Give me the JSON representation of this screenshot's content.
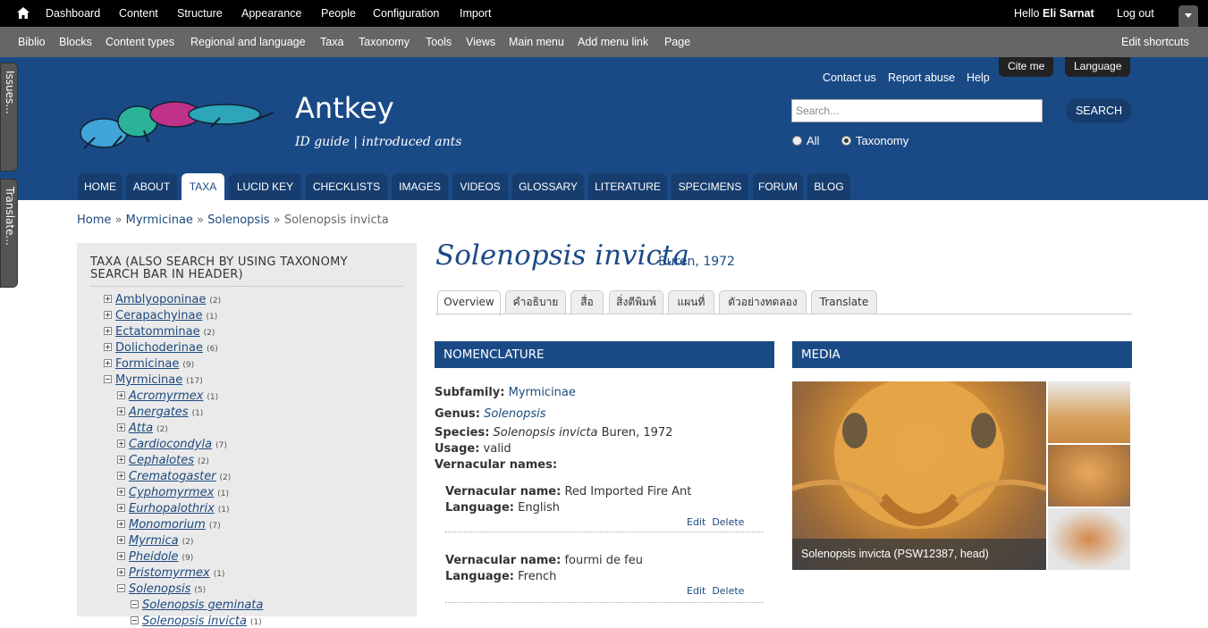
{
  "toolbar": {
    "items": [
      "Dashboard",
      "Content",
      "Structure",
      "Appearance",
      "People",
      "Configuration",
      "Import"
    ],
    "greeting": "Hello",
    "user": "Eli Sarnat",
    "logout": "Log out"
  },
  "shortcuts": {
    "items": [
      "Biblio",
      "Blocks",
      "Content types",
      "Regional and language",
      "Taxa",
      "Taxonomy",
      "Tools",
      "Views",
      "Main menu",
      "Add menu link",
      "Page"
    ],
    "edit": "Edit shortcuts"
  },
  "side_handles": [
    "Issues...",
    "Translate..."
  ],
  "header": {
    "site_name": "Antkey",
    "slogan": "ID guide | introduced ants",
    "top_links": [
      "Contact us",
      "Report abuse",
      "Help"
    ],
    "top_buttons": [
      "Cite me",
      "Language"
    ],
    "search_placeholder": "Search...",
    "search_button": "SEARCH",
    "radio_all": "All",
    "radio_taxonomy": "Taxonomy",
    "nav": [
      "HOME",
      "ABOUT",
      "TAXA",
      "LUCID KEY",
      "CHECKLISTS",
      "IMAGES",
      "VIDEOS",
      "GLOSSARY",
      "LITERATURE",
      "SPECIMENS",
      "FORUM",
      "BLOG"
    ],
    "active_nav": "TAXA",
    "colors": {
      "header_bg": "#1a4a86",
      "nav_tab": "#173d6f"
    }
  },
  "breadcrumb": {
    "links": [
      "Home",
      "Myrmicinae",
      "Solenopsis"
    ],
    "separator": "»",
    "current": "Solenopsis invicta"
  },
  "sidebar": {
    "title": "TAXA (ALSO SEARCH BY USING TAXONOMY SEARCH BAR IN HEADER)",
    "subfamilies": [
      {
        "name": "Amblyoponinae",
        "count": "(2)"
      },
      {
        "name": "Cerapachyinae",
        "count": "(1)"
      },
      {
        "name": "Ectatomminae",
        "count": "(2)"
      },
      {
        "name": "Dolichoderinae",
        "count": "(6)"
      },
      {
        "name": "Formicinae",
        "count": "(9)"
      },
      {
        "name": "Myrmicinae",
        "count": "(17)"
      }
    ],
    "genera": [
      {
        "name": "Acromyrmex",
        "count": "(1)"
      },
      {
        "name": "Anergates",
        "count": "(1)"
      },
      {
        "name": "Atta",
        "count": "(2)"
      },
      {
        "name": "Cardiocondyla",
        "count": "(7)"
      },
      {
        "name": "Cephalotes",
        "count": "(2)"
      },
      {
        "name": "Crematogaster",
        "count": "(2)"
      },
      {
        "name": "Cyphomyrmex",
        "count": "(1)"
      },
      {
        "name": "Eurhopalothrix",
        "count": "(1)"
      },
      {
        "name": "Monomorium",
        "count": "(7)"
      },
      {
        "name": "Myrmica",
        "count": "(2)"
      },
      {
        "name": "Pheidole",
        "count": "(9)"
      },
      {
        "name": "Pristomyrmex",
        "count": "(1)"
      },
      {
        "name": "Solenopsis",
        "count": "(5)"
      }
    ],
    "species": [
      {
        "name": "Solenopsis geminata",
        "count": ""
      },
      {
        "name": "Solenopsis invicta",
        "count": "(1)"
      }
    ]
  },
  "page": {
    "title": "Solenopsis invicta",
    "author": "Buren, 1972",
    "tabs": [
      "Overview",
      "คำอธิบาย",
      "สื่อ",
      "สิ่งตีพิมพ์",
      "แผนที่",
      "ตัวอย่างทดลอง",
      "Translate"
    ],
    "active_tab": "Overview"
  },
  "nomenclature": {
    "heading": "NOMENCLATURE",
    "subfamily_label": "Subfamily:",
    "subfamily": "Myrmicinae",
    "genus_label": "Genus:",
    "genus": "Solenopsis",
    "species_label": "Species:",
    "species_name": "Solenopsis invicta",
    "species_author": "Buren, 1972",
    "usage_label": "Usage:",
    "usage": "valid",
    "vernacular_label": "Vernacular names:",
    "vernacular": [
      {
        "name_label": "Vernacular name:",
        "name": "Red Imported Fire Ant",
        "lang_label": "Language:",
        "lang": "English"
      },
      {
        "name_label": "Vernacular name:",
        "name": "fourmi de feu",
        "lang_label": "Language:",
        "lang": "French"
      }
    ],
    "edit": "Edit",
    "delete": "Delete"
  },
  "media": {
    "heading": "MEDIA",
    "caption": "Solenopsis invicta (PSW12387, head)"
  }
}
